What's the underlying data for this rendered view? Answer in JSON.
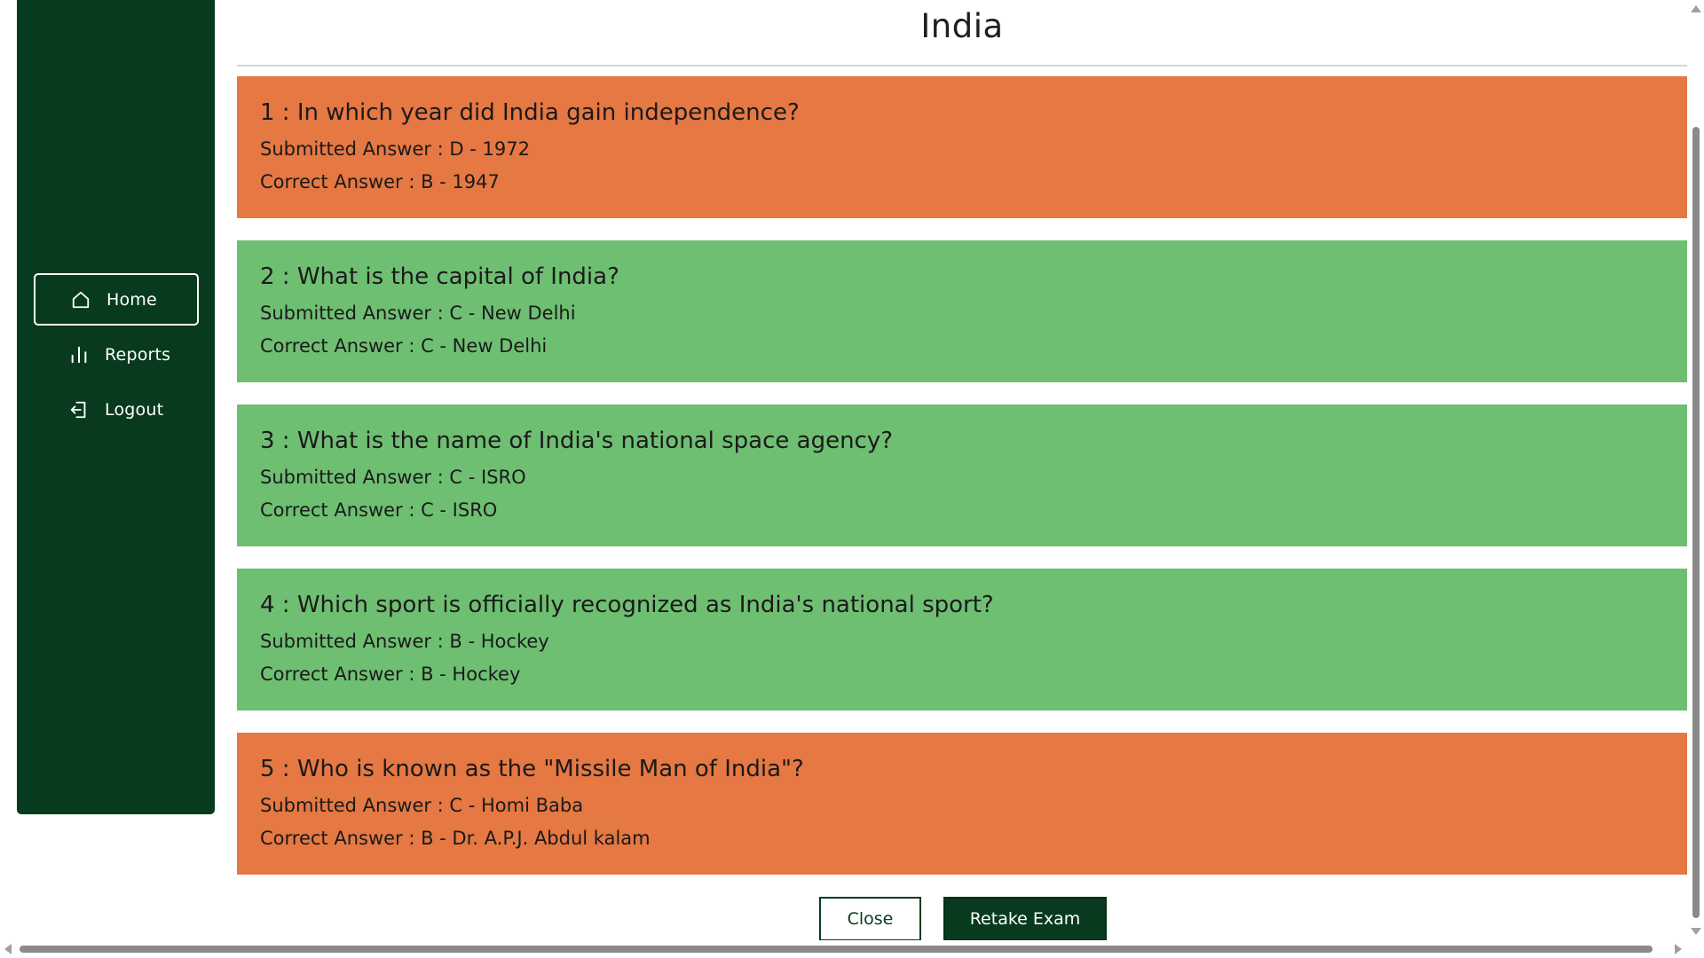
{
  "sidebar": {
    "items": [
      {
        "label": "Home",
        "icon": "home-icon",
        "active": true
      },
      {
        "label": "Reports",
        "icon": "bar-chart-icon",
        "active": false
      },
      {
        "label": "Logout",
        "icon": "logout-icon",
        "active": false
      }
    ]
  },
  "main": {
    "title": "India",
    "questions": [
      {
        "question": "1 : In which year did India gain independence?",
        "submitted": "Submitted Answer : D - 1972",
        "correct": "Correct Answer : B - 1947",
        "status": "incorrect"
      },
      {
        "question": "2 : What is the capital of India?",
        "submitted": "Submitted Answer : C - New Delhi",
        "correct": "Correct Answer : C - New Delhi",
        "status": "correct"
      },
      {
        "question": "3 : What is the name of India's national space agency?",
        "submitted": "Submitted Answer : C - ISRO",
        "correct": "Correct Answer : C - ISRO",
        "status": "correct"
      },
      {
        "question": "4 : Which sport is officially recognized as India's national sport?",
        "submitted": "Submitted Answer : B - Hockey",
        "correct": "Correct Answer : B - Hockey",
        "status": "correct"
      },
      {
        "question": "5 : Who is known as the \"Missile Man of India\"?",
        "submitted": "Submitted Answer : C - Homi Baba",
        "correct": "Correct Answer : B - Dr. A.P.J. Abdul kalam",
        "status": "incorrect"
      }
    ]
  },
  "footer": {
    "close_label": "Close",
    "retake_label": "Retake Exam"
  },
  "colors": {
    "sidebar": "#083b1e",
    "correct": "#6ebf72",
    "incorrect": "#e57843",
    "primary_button": "#083b1e"
  }
}
